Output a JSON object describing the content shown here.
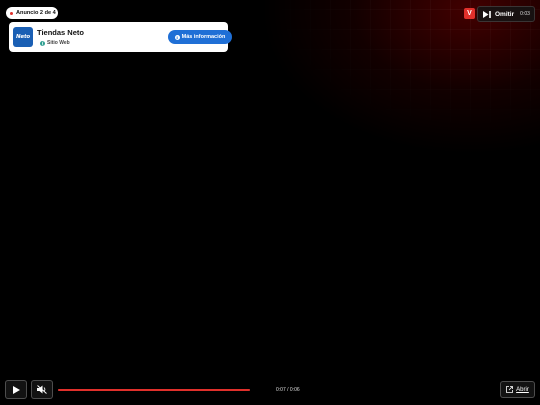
{
  "ad_counter": {
    "label": "Anuncio 2 de 4"
  },
  "advertiser": {
    "logo_text": "Neto",
    "name": "Tiendas Neto",
    "site_label": "Sitio Web"
  },
  "cta": {
    "label": "Más información"
  },
  "brand_badge": {
    "label": "V"
  },
  "skip": {
    "label": "Omitir",
    "countdown": "0:03"
  },
  "player": {
    "time": "0:07 / 0:06",
    "progress": 1.0,
    "open_label": "Abrir"
  },
  "colors": {
    "accent_red": "#e0302b",
    "cta_blue": "#1f6fd6",
    "logo_blue": "#1a5fb4"
  },
  "icons": {
    "play": "play-icon",
    "mute": "volume-muted-icon",
    "skip": "skip-next-icon",
    "open": "external-link-icon",
    "info": "info-icon",
    "globe": "globe-icon"
  }
}
